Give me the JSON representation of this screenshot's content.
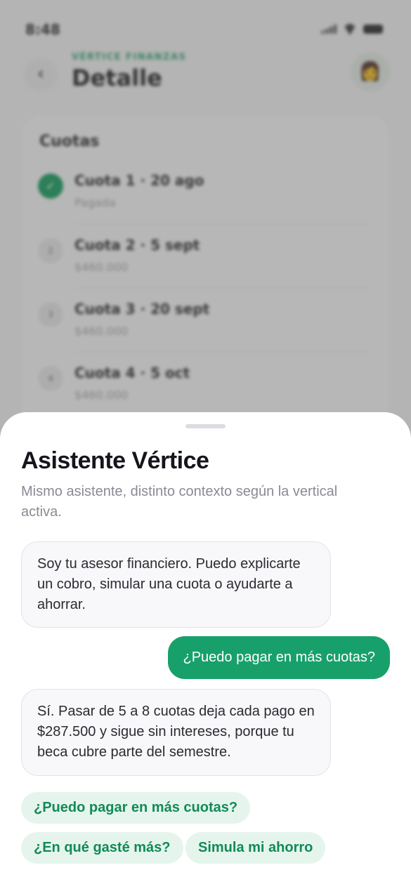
{
  "status_bar": {
    "time": "8:48"
  },
  "header": {
    "back_icon": "‹",
    "brand": "VÉRTICE FINANZAS",
    "title": "Detalle",
    "avatar_icon": "👩"
  },
  "cuotas_card": {
    "title": "Cuotas",
    "items": [
      {
        "number": "✓",
        "title": "Cuota 1 · 20 ago",
        "subtitle": "Pagada",
        "paid": true
      },
      {
        "number": "2",
        "title": "Cuota 2 · 5 sept",
        "subtitle": "$460.000",
        "paid": false
      },
      {
        "number": "3",
        "title": "Cuota 3 · 20 sept",
        "subtitle": "$460.000",
        "paid": false
      },
      {
        "number": "4",
        "title": "Cuota 4 · 5 oct",
        "subtitle": "$460.000",
        "paid": false
      }
    ]
  },
  "assistant": {
    "title": "Asistente Vértice",
    "subtitle": "Mismo asistente, distinto contexto según la vertical activa.",
    "messages": [
      {
        "role": "assistant",
        "text": "Soy tu asesor financiero. Puedo explicarte un cobro, simular una cuota o ayudarte a ahorrar."
      },
      {
        "role": "user",
        "text": "¿Puedo pagar en más cuotas?"
      },
      {
        "role": "assistant",
        "text": "Sí. Pasar de 5 a 8 cuotas deja cada pago en $287.500 y sigue sin intereses, porque tu beca cubre parte del semestre."
      }
    ],
    "suggestions": [
      "¿Puedo pagar en más cuotas?",
      "¿En qué gasté más?",
      "Simula mi ahorro"
    ]
  },
  "colors": {
    "accent": "#18a06b",
    "chip_bg": "#e5f5ed",
    "chip_text": "#128a57"
  }
}
